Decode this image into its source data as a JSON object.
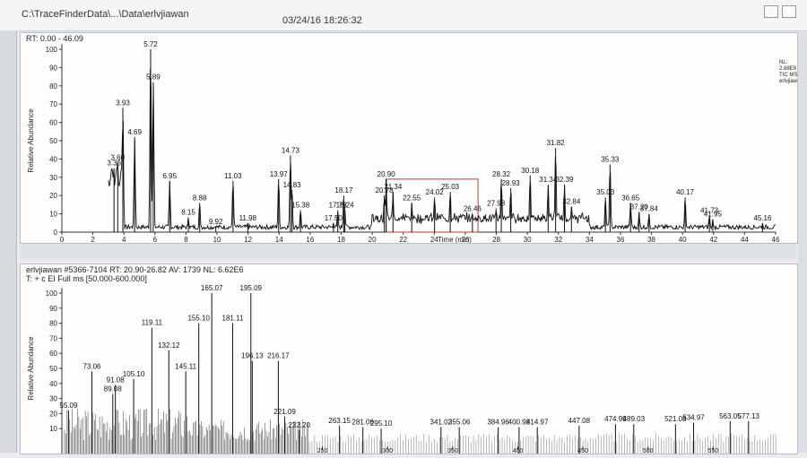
{
  "window": {
    "path": "C:\\TraceFinderData\\...\\Data\\erlvjiawan",
    "timestamp": "03/24/16 18:26:32"
  },
  "chromatogram": {
    "header": "RT: 0.00 - 46.09",
    "side_labels": [
      "NL:",
      "2.88E9",
      "TIC MS",
      "erlvjiawan"
    ]
  },
  "spectrum": {
    "header1": "erlvjiawan #5366-7104   RT: 20.90-26.82   AV: 1739   NL: 6.62E6",
    "header2": "T: + c EI Full ms [50.000-600.000]"
  },
  "chart_data": [
    {
      "type": "line",
      "ylabel": "Relative Abundance",
      "xlabel": "Time (min)",
      "xlim": [
        0,
        46
      ],
      "ylim": [
        0,
        100
      ],
      "xticks": [
        0,
        2,
        4,
        6,
        8,
        10,
        12,
        14,
        16,
        18,
        20,
        22,
        24,
        26,
        28,
        30,
        32,
        34,
        36,
        38,
        40,
        42,
        44,
        46
      ],
      "yticks": [
        0,
        10,
        20,
        30,
        40,
        50,
        60,
        70,
        80,
        90,
        100
      ],
      "peaks": [
        {
          "label": "3.36",
          "x": 3.36,
          "y": 35
        },
        {
          "label": "3.60",
          "x": 3.6,
          "y": 38
        },
        {
          "label": "3.93",
          "x": 3.93,
          "y": 68
        },
        {
          "label": "4.69",
          "x": 4.69,
          "y": 52
        },
        {
          "label": "5.72",
          "x": 5.72,
          "y": 100
        },
        {
          "label": "5.89",
          "x": 5.89,
          "y": 82
        },
        {
          "label": "6.95",
          "x": 6.95,
          "y": 28
        },
        {
          "label": "8.15",
          "x": 8.15,
          "y": 8
        },
        {
          "label": "8.88",
          "x": 8.88,
          "y": 16
        },
        {
          "label": "9.92",
          "x": 9.92,
          "y": 3
        },
        {
          "label": "11.03",
          "x": 11.03,
          "y": 28
        },
        {
          "label": "11.98",
          "x": 11.98,
          "y": 5
        },
        {
          "label": "13.97",
          "x": 13.97,
          "y": 29
        },
        {
          "label": "14.73",
          "x": 14.73,
          "y": 42
        },
        {
          "label": "14.83",
          "x": 14.83,
          "y": 23
        },
        {
          "label": "15.38",
          "x": 15.38,
          "y": 12
        },
        {
          "label": "17.50",
          "x": 17.5,
          "y": 5
        },
        {
          "label": "17.78",
          "x": 17.78,
          "y": 12
        },
        {
          "label": "18.17",
          "x": 18.17,
          "y": 20
        },
        {
          "label": "18.24",
          "x": 18.24,
          "y": 12
        },
        {
          "label": "20.78",
          "x": 20.78,
          "y": 20
        },
        {
          "label": "20.90",
          "x": 20.9,
          "y": 29
        },
        {
          "label": "21.34",
          "x": 21.34,
          "y": 22
        },
        {
          "label": "22.55",
          "x": 22.55,
          "y": 16
        },
        {
          "label": "24.02",
          "x": 24.02,
          "y": 19
        },
        {
          "label": "25.03",
          "x": 25.03,
          "y": 22
        },
        {
          "label": "26.46",
          "x": 26.46,
          "y": 10
        },
        {
          "label": "27.98",
          "x": 27.98,
          "y": 13
        },
        {
          "label": "28.32",
          "x": 28.32,
          "y": 29
        },
        {
          "label": "28.93",
          "x": 28.93,
          "y": 24
        },
        {
          "label": "30.18",
          "x": 30.18,
          "y": 31
        },
        {
          "label": "31.34",
          "x": 31.34,
          "y": 26
        },
        {
          "label": "31.82",
          "x": 31.82,
          "y": 46
        },
        {
          "label": "32.39",
          "x": 32.39,
          "y": 26
        },
        {
          "label": "32.84",
          "x": 32.84,
          "y": 14
        },
        {
          "label": "35.03",
          "x": 35.03,
          "y": 19
        },
        {
          "label": "35.33",
          "x": 35.33,
          "y": 37
        },
        {
          "label": "36.65",
          "x": 36.65,
          "y": 16
        },
        {
          "label": "37.20",
          "x": 37.2,
          "y": 11
        },
        {
          "label": "37.84",
          "x": 37.84,
          "y": 10
        },
        {
          "label": "40.17",
          "x": 40.17,
          "y": 19
        },
        {
          "label": "41.73",
          "x": 41.73,
          "y": 9
        },
        {
          "label": "41.95",
          "x": 41.95,
          "y": 7
        },
        {
          "label": "45.16",
          "x": 45.16,
          "y": 5
        }
      ],
      "highlight_range": [
        20.9,
        26.82
      ]
    },
    {
      "type": "bar",
      "ylabel": "Relative Abundance",
      "xlim": [
        50,
        600
      ],
      "ylim": [
        0,
        100
      ],
      "xticks": [
        250,
        300,
        350,
        400,
        450,
        500,
        550
      ],
      "yticks": [
        10,
        20,
        30,
        40,
        50,
        60,
        70,
        80,
        90,
        100
      ],
      "peaks": [
        {
          "label": "55.09",
          "x": 55.09,
          "y": 22
        },
        {
          "label": "73.06",
          "x": 73.06,
          "y": 48
        },
        {
          "label": "89.08",
          "x": 89.08,
          "y": 33
        },
        {
          "label": "91.08",
          "x": 91.08,
          "y": 39
        },
        {
          "label": "105.10",
          "x": 105.1,
          "y": 43
        },
        {
          "label": "119.11",
          "x": 119.11,
          "y": 77
        },
        {
          "label": "132.12",
          "x": 132.12,
          "y": 62
        },
        {
          "label": "145.11",
          "x": 145.11,
          "y": 48
        },
        {
          "label": "155.10",
          "x": 155.1,
          "y": 80
        },
        {
          "label": "165.07",
          "x": 165.07,
          "y": 100
        },
        {
          "label": "181.11",
          "x": 181.11,
          "y": 80
        },
        {
          "label": "195.09",
          "x": 195.09,
          "y": 100
        },
        {
          "label": "196.13",
          "x": 196.13,
          "y": 55
        },
        {
          "label": "216.17",
          "x": 216.17,
          "y": 55
        },
        {
          "label": "221.09",
          "x": 221.09,
          "y": 18
        },
        {
          "label": "232.20",
          "x": 232.2,
          "y": 9
        },
        {
          "label": "263.15",
          "x": 263.15,
          "y": 12
        },
        {
          "label": "281.06",
          "x": 281.06,
          "y": 11
        },
        {
          "label": "295.10",
          "x": 295.1,
          "y": 10
        },
        {
          "label": "341.02",
          "x": 341.02,
          "y": 11
        },
        {
          "label": "355.06",
          "x": 355.06,
          "y": 11
        },
        {
          "label": "384.96",
          "x": 384.96,
          "y": 11
        },
        {
          "label": "400.98",
          "x": 400.98,
          "y": 11
        },
        {
          "label": "414.97",
          "x": 414.97,
          "y": 11
        },
        {
          "label": "447.08",
          "x": 447.08,
          "y": 12
        },
        {
          "label": "474.99",
          "x": 474.99,
          "y": 13
        },
        {
          "label": "489.03",
          "x": 489.03,
          "y": 13
        },
        {
          "label": "521.08",
          "x": 521.08,
          "y": 13
        },
        {
          "label": "534.97",
          "x": 534.97,
          "y": 14
        },
        {
          "label": "563.05",
          "x": 563.05,
          "y": 15
        },
        {
          "label": "577.13",
          "x": 577.13,
          "y": 15
        }
      ]
    }
  ]
}
